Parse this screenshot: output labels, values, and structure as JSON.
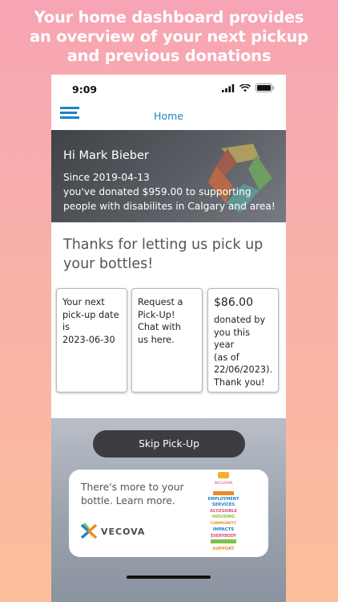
{
  "headline": {
    "line1": "Your home dashboard provides",
    "line2": "an overview of your next pickup",
    "line3": "and previous donations"
  },
  "status_bar": {
    "time": "9:09"
  },
  "nav": {
    "title": "Home"
  },
  "hero": {
    "greeting": "Hi Mark Bieber",
    "since_line": "Since 2019-04-13",
    "donated_line": "you've donated $959.00 to supporting",
    "purpose_line": "people with disabilites in Calgary and area!"
  },
  "thanks": "Thanks for letting us pick up your bottles!",
  "cards": {
    "next_pickup": {
      "line1": "Your next",
      "line2": "pick-up date",
      "line3": "is",
      "line4": "2023-06-30"
    },
    "request": {
      "line1": "Request a",
      "line2": "Pick-Up!",
      "line3": "Chat with",
      "line4": "us here."
    },
    "donated": {
      "amount": "$86.00",
      "line1": "donated by",
      "line2": "you this year",
      "line3": "(as of",
      "line4": "22/06/2023).",
      "line5": "Thank you!"
    }
  },
  "skip_button": "Skip Pick-Up",
  "promo": {
    "text": "There's more to your bottle. Learn more.",
    "brand": "VECOVA",
    "bottle_words": [
      "INCLUSION",
      "EMPLOYMENT",
      "SERVICES",
      "ACCESSIBLE",
      "HOUSING",
      "COMMUNITY",
      "IMPACTS",
      "EVERYBODY",
      "SUPPORT"
    ]
  },
  "colors": {
    "accent": "#1c83c5",
    "hero_bg": "#4d5156",
    "button_bg": "#3b3d41",
    "background_top": "#f7a4b4",
    "background_bottom": "#fbbf9c"
  }
}
